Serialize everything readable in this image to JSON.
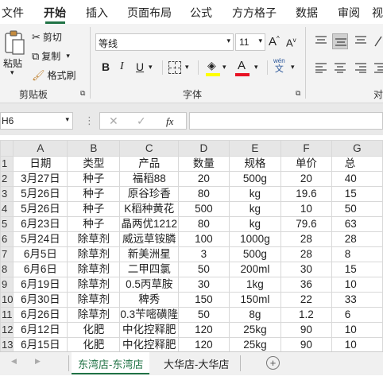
{
  "menu": {
    "items": [
      "文件",
      "开始",
      "插入",
      "页面布局",
      "公式",
      "方方格子",
      "数据",
      "审阅",
      "视"
    ]
  },
  "ribbon": {
    "paste_label": "粘贴",
    "cut_label": "剪切",
    "copy_label": "复制",
    "format_painter_label": "格式刷",
    "clipboard_group": "剪贴板",
    "font_group": "字体",
    "font_name": "等线",
    "font_size": "11",
    "bold": "B",
    "italic": "I",
    "underline": "U",
    "phonetic": "wén\n文",
    "font_color_accent": "#e81123",
    "highlight_accent": "#ffff00"
  },
  "formula_bar": {
    "name_box": "H6",
    "cancel": "✕",
    "confirm": "✓",
    "fx": "fx",
    "value": ""
  },
  "grid": {
    "columns": [
      "A",
      "B",
      "C",
      "D",
      "E",
      "F",
      "G"
    ],
    "rows": [
      {
        "n": "1",
        "cells": [
          "日期",
          "类型",
          "产品",
          "数量",
          "规格",
          "单价",
          "总"
        ]
      },
      {
        "n": "2",
        "cells": [
          "3月27日",
          "种子",
          "福稻88",
          "20",
          "500g",
          "20",
          "40"
        ]
      },
      {
        "n": "3",
        "cells": [
          "5月26日",
          "种子",
          "原谷珍香",
          "80",
          "kg",
          "19.6",
          "15"
        ]
      },
      {
        "n": "4",
        "cells": [
          "5月26日",
          "种子",
          "K稻种黄花",
          "500",
          "kg",
          "10",
          "50"
        ]
      },
      {
        "n": "5",
        "cells": [
          "6月23日",
          "种子",
          "晶两优1212",
          "80",
          "kg",
          "79.6",
          "63"
        ]
      },
      {
        "n": "6",
        "cells": [
          "5月24日",
          "除草剂",
          "威远草铵膦",
          "100",
          "1000g",
          "28",
          "28"
        ]
      },
      {
        "n": "7",
        "cells": [
          "6月5日",
          "除草剂",
          "新美洲星",
          "3",
          "500g",
          "28",
          "8"
        ]
      },
      {
        "n": "8",
        "cells": [
          "6月6日",
          "除草剂",
          "二甲四氯",
          "50",
          "200ml",
          "30",
          "15"
        ]
      },
      {
        "n": "9",
        "cells": [
          "6月19日",
          "除草剂",
          "0.5丙草胺",
          "30",
          "1kg",
          "36",
          "10"
        ]
      },
      {
        "n": "10",
        "cells": [
          "6月30日",
          "除草剂",
          "稗秀",
          "150",
          "150ml",
          "22",
          "33"
        ]
      },
      {
        "n": "11",
        "cells": [
          "6月26日",
          "除草剂",
          "0.3苄嘧磺隆",
          "50",
          "8g",
          "1.2",
          "6"
        ]
      },
      {
        "n": "12",
        "cells": [
          "6月12日",
          "化肥",
          "中化控释肥",
          "120",
          "25kg",
          "90",
          "10"
        ]
      },
      {
        "n": "13",
        "cells": [
          "6月15日",
          "化肥",
          "中化控释肥",
          "120",
          "25kg",
          "90",
          "10"
        ]
      }
    ]
  },
  "sheet_tabs": {
    "tabs": [
      "东湾店-东湾店",
      "大华店-大华店"
    ],
    "active": 0,
    "add": "+",
    "prev": "◀",
    "next": "▶"
  },
  "colors": {
    "accent": "#217346"
  }
}
